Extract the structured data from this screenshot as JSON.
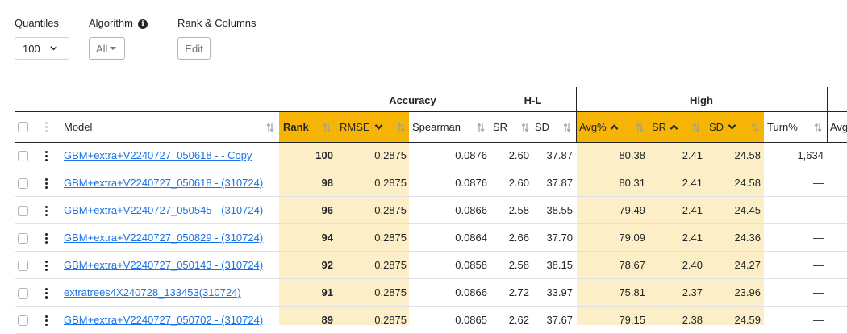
{
  "filters": {
    "quantiles": {
      "label": "Quantiles",
      "value": "100"
    },
    "algorithm": {
      "label": "Algorithm",
      "value": "All"
    },
    "rank_columns": {
      "label": "Rank & Columns",
      "button": "Edit"
    }
  },
  "table": {
    "groups": {
      "accuracy": "Accuracy",
      "hl": "H-L",
      "high": "High"
    },
    "columns": {
      "model": "Model",
      "rank": "Rank",
      "rmse": "RMSE",
      "spearman": "Spearman",
      "hl_sr": "SR",
      "hl_sd": "SD",
      "avg": "Avg%",
      "high_sr": "SR",
      "high_sd": "SD",
      "turn": "Turn%",
      "avg_cut": "Avg"
    },
    "rows": [
      {
        "model": "GBM+extra+V2240727_050618 - - Copy",
        "rank": "100",
        "rmse": "0.2875",
        "spearman": "0.0876",
        "hl_sr": "2.60",
        "hl_sd": "37.87",
        "avg": "80.38",
        "high_sr": "2.41",
        "high_sd": "24.58",
        "turn": "1,634"
      },
      {
        "model": "GBM+extra+V2240727_050618 - (310724)",
        "rank": "98",
        "rmse": "0.2875",
        "spearman": "0.0876",
        "hl_sr": "2.60",
        "hl_sd": "37.87",
        "avg": "80.31",
        "high_sr": "2.41",
        "high_sd": "24.58",
        "turn": "—"
      },
      {
        "model": "GBM+extra+V2240727_050545 - (310724)",
        "rank": "96",
        "rmse": "0.2875",
        "spearman": "0.0866",
        "hl_sr": "2.58",
        "hl_sd": "38.55",
        "avg": "79.49",
        "high_sr": "2.41",
        "high_sd": "24.45",
        "turn": "—"
      },
      {
        "model": "GBM+extra+V2240727_050829 - (310724)",
        "rank": "94",
        "rmse": "0.2875",
        "spearman": "0.0864",
        "hl_sr": "2.66",
        "hl_sd": "37.70",
        "avg": "79.09",
        "high_sr": "2.41",
        "high_sd": "24.36",
        "turn": "—"
      },
      {
        "model": "GBM+extra+V2240727_050143 - (310724)",
        "rank": "92",
        "rmse": "0.2875",
        "spearman": "0.0858",
        "hl_sr": "2.58",
        "hl_sd": "38.15",
        "avg": "78.67",
        "high_sr": "2.40",
        "high_sd": "24.27",
        "turn": "—"
      },
      {
        "model": "extratrees4X240728_133453(310724)",
        "rank": "91",
        "rmse": "0.2875",
        "spearman": "0.0866",
        "hl_sr": "2.72",
        "hl_sd": "33.97",
        "avg": "75.81",
        "high_sr": "2.37",
        "high_sd": "23.96",
        "turn": "—"
      },
      {
        "model": "GBM+extra+V2240727_050702 - (310724)",
        "rank": "89",
        "rmse": "0.2875",
        "spearman": "0.0865",
        "hl_sr": "2.62",
        "hl_sd": "37.67",
        "avg": "79.15",
        "high_sr": "2.38",
        "high_sd": "24.59",
        "turn": "—"
      }
    ]
  },
  "icons": {
    "info": "info-circle-icon",
    "chevron": "chevron-down-icon",
    "sort": "sort-arrows-icon",
    "kebab": "kebab-menu-icon"
  },
  "colors": {
    "highlight_header": "#f5b406",
    "highlight_cell": "#fcefc7",
    "link": "#1a73e8"
  }
}
